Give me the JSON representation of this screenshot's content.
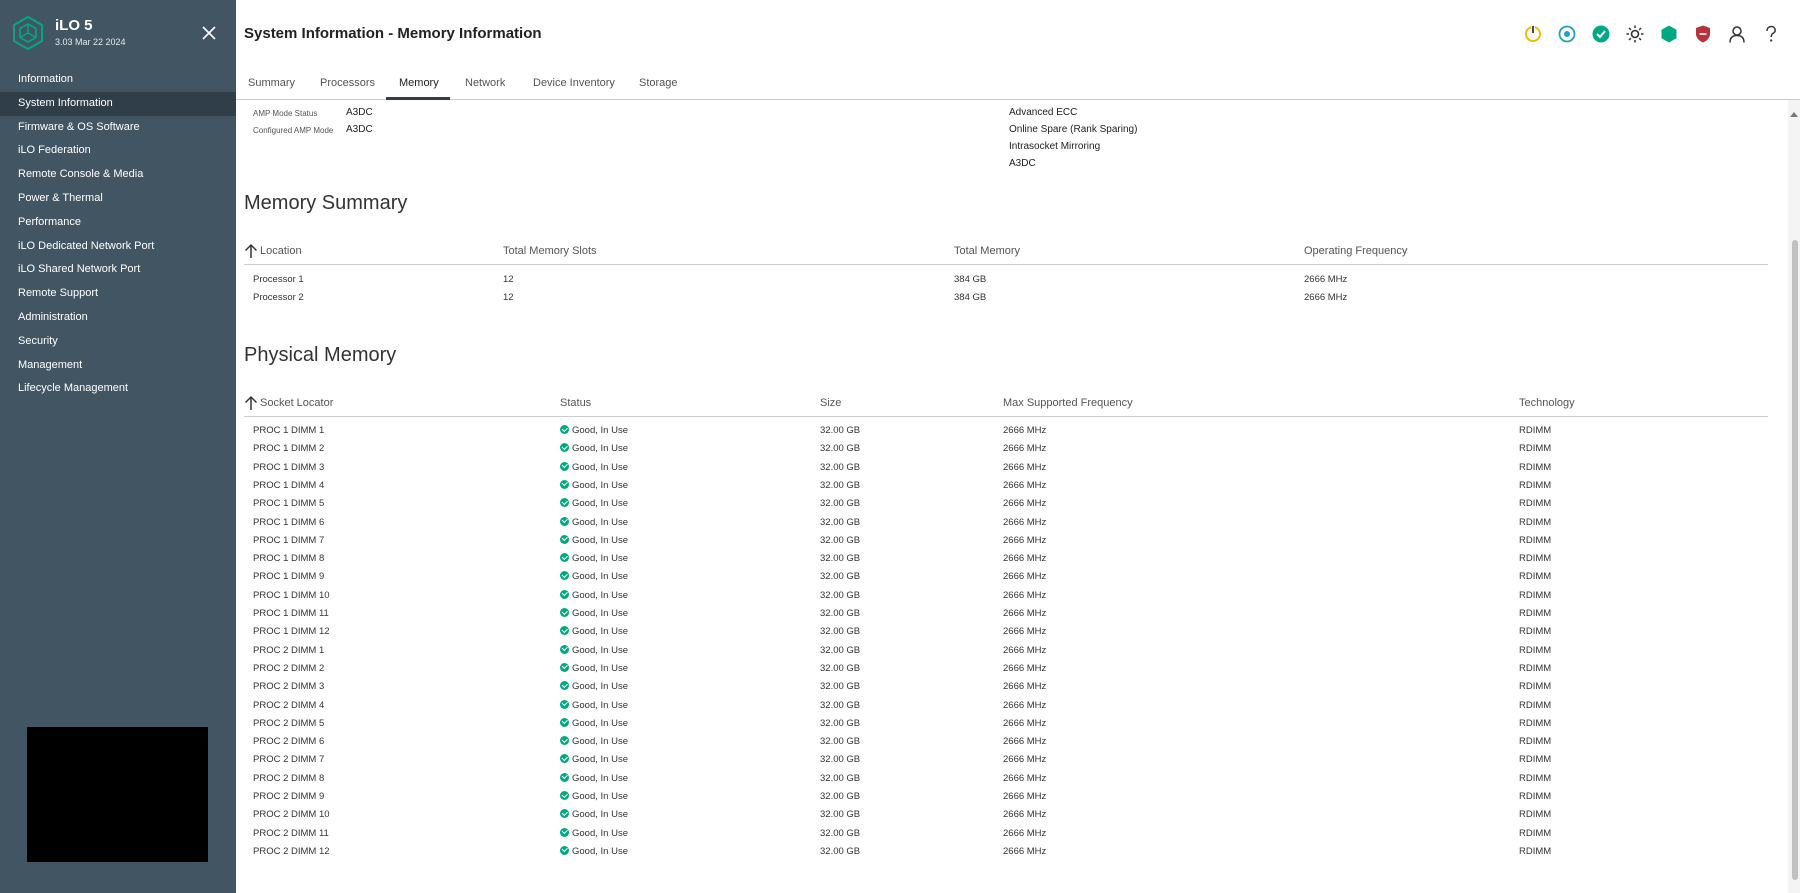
{
  "app": {
    "name": "iLO 5",
    "version": "3.03 Mar 22 2024"
  },
  "sidebar": {
    "items": [
      {
        "label": "Information"
      },
      {
        "label": "System Information"
      },
      {
        "label": "Firmware & OS Software"
      },
      {
        "label": "iLO Federation"
      },
      {
        "label": "Remote Console & Media"
      },
      {
        "label": "Power & Thermal"
      },
      {
        "label": "Performance"
      },
      {
        "label": "iLO Dedicated Network Port"
      },
      {
        "label": "iLO Shared Network Port"
      },
      {
        "label": "Remote Support"
      },
      {
        "label": "Administration"
      },
      {
        "label": "Security"
      },
      {
        "label": "Management"
      },
      {
        "label": "Lifecycle Management"
      }
    ],
    "active_index": 1
  },
  "header": {
    "title": "System Information - Memory Information",
    "tabs": [
      "Summary",
      "Processors",
      "Memory",
      "Network",
      "Device Inventory",
      "Storage"
    ],
    "active_tab": "Memory",
    "icons": [
      "power-icon",
      "uid-indicator-icon",
      "health-ok-icon",
      "brightness-icon",
      "security-shield-icon",
      "security-risk-icon",
      "user-icon",
      "help-icon"
    ],
    "colors": {
      "power": "#f5b800",
      "uid": "#1fa0c4",
      "health": "#01a982",
      "security_ok": "#01a982",
      "security_risk": "#b5343c"
    }
  },
  "amp": {
    "mode_status_label": "AMP Mode Status",
    "mode_status_value": "A3DC",
    "configured_label": "Configured AMP Mode",
    "configured_value": "A3DC",
    "supported_modes": [
      "Advanced ECC",
      "Online Spare (Rank Sparing)",
      "Intrasocket Mirroring",
      "A3DC"
    ]
  },
  "memory_summary": {
    "title": "Memory Summary",
    "columns": [
      "Location",
      "Total Memory Slots",
      "Total Memory",
      "Operating Frequency"
    ],
    "rows": [
      [
        "Processor 1",
        "12",
        "384 GB",
        "2666 MHz"
      ],
      [
        "Processor 2",
        "12",
        "384 GB",
        "2666 MHz"
      ]
    ]
  },
  "physical_memory": {
    "title": "Physical Memory",
    "columns": [
      "Socket Locator",
      "Status",
      "Size",
      "Max Supported Frequency",
      "Technology"
    ],
    "rows": [
      [
        "PROC 1 DIMM 1",
        "Good, In Use",
        "32.00 GB",
        "2666 MHz",
        "RDIMM"
      ],
      [
        "PROC 1 DIMM 2",
        "Good, In Use",
        "32.00 GB",
        "2666 MHz",
        "RDIMM"
      ],
      [
        "PROC 1 DIMM 3",
        "Good, In Use",
        "32.00 GB",
        "2666 MHz",
        "RDIMM"
      ],
      [
        "PROC 1 DIMM 4",
        "Good, In Use",
        "32.00 GB",
        "2666 MHz",
        "RDIMM"
      ],
      [
        "PROC 1 DIMM 5",
        "Good, In Use",
        "32.00 GB",
        "2666 MHz",
        "RDIMM"
      ],
      [
        "PROC 1 DIMM 6",
        "Good, In Use",
        "32.00 GB",
        "2666 MHz",
        "RDIMM"
      ],
      [
        "PROC 1 DIMM 7",
        "Good, In Use",
        "32.00 GB",
        "2666 MHz",
        "RDIMM"
      ],
      [
        "PROC 1 DIMM 8",
        "Good, In Use",
        "32.00 GB",
        "2666 MHz",
        "RDIMM"
      ],
      [
        "PROC 1 DIMM 9",
        "Good, In Use",
        "32.00 GB",
        "2666 MHz",
        "RDIMM"
      ],
      [
        "PROC 1 DIMM 10",
        "Good, In Use",
        "32.00 GB",
        "2666 MHz",
        "RDIMM"
      ],
      [
        "PROC 1 DIMM 11",
        "Good, In Use",
        "32.00 GB",
        "2666 MHz",
        "RDIMM"
      ],
      [
        "PROC 1 DIMM 12",
        "Good, In Use",
        "32.00 GB",
        "2666 MHz",
        "RDIMM"
      ],
      [
        "PROC 2 DIMM 1",
        "Good, In Use",
        "32.00 GB",
        "2666 MHz",
        "RDIMM"
      ],
      [
        "PROC 2 DIMM 2",
        "Good, In Use",
        "32.00 GB",
        "2666 MHz",
        "RDIMM"
      ],
      [
        "PROC 2 DIMM 3",
        "Good, In Use",
        "32.00 GB",
        "2666 MHz",
        "RDIMM"
      ],
      [
        "PROC 2 DIMM 4",
        "Good, In Use",
        "32.00 GB",
        "2666 MHz",
        "RDIMM"
      ],
      [
        "PROC 2 DIMM 5",
        "Good, In Use",
        "32.00 GB",
        "2666 MHz",
        "RDIMM"
      ],
      [
        "PROC 2 DIMM 6",
        "Good, In Use",
        "32.00 GB",
        "2666 MHz",
        "RDIMM"
      ],
      [
        "PROC 2 DIMM 7",
        "Good, In Use",
        "32.00 GB",
        "2666 MHz",
        "RDIMM"
      ],
      [
        "PROC 2 DIMM 8",
        "Good, In Use",
        "32.00 GB",
        "2666 MHz",
        "RDIMM"
      ],
      [
        "PROC 2 DIMM 9",
        "Good, In Use",
        "32.00 GB",
        "2666 MHz",
        "RDIMM"
      ],
      [
        "PROC 2 DIMM 10",
        "Good, In Use",
        "32.00 GB",
        "2666 MHz",
        "RDIMM"
      ],
      [
        "PROC 2 DIMM 11",
        "Good, In Use",
        "32.00 GB",
        "2666 MHz",
        "RDIMM"
      ],
      [
        "PROC 2 DIMM 12",
        "Good, In Use",
        "32.00 GB",
        "2666 MHz",
        "RDIMM"
      ]
    ]
  }
}
